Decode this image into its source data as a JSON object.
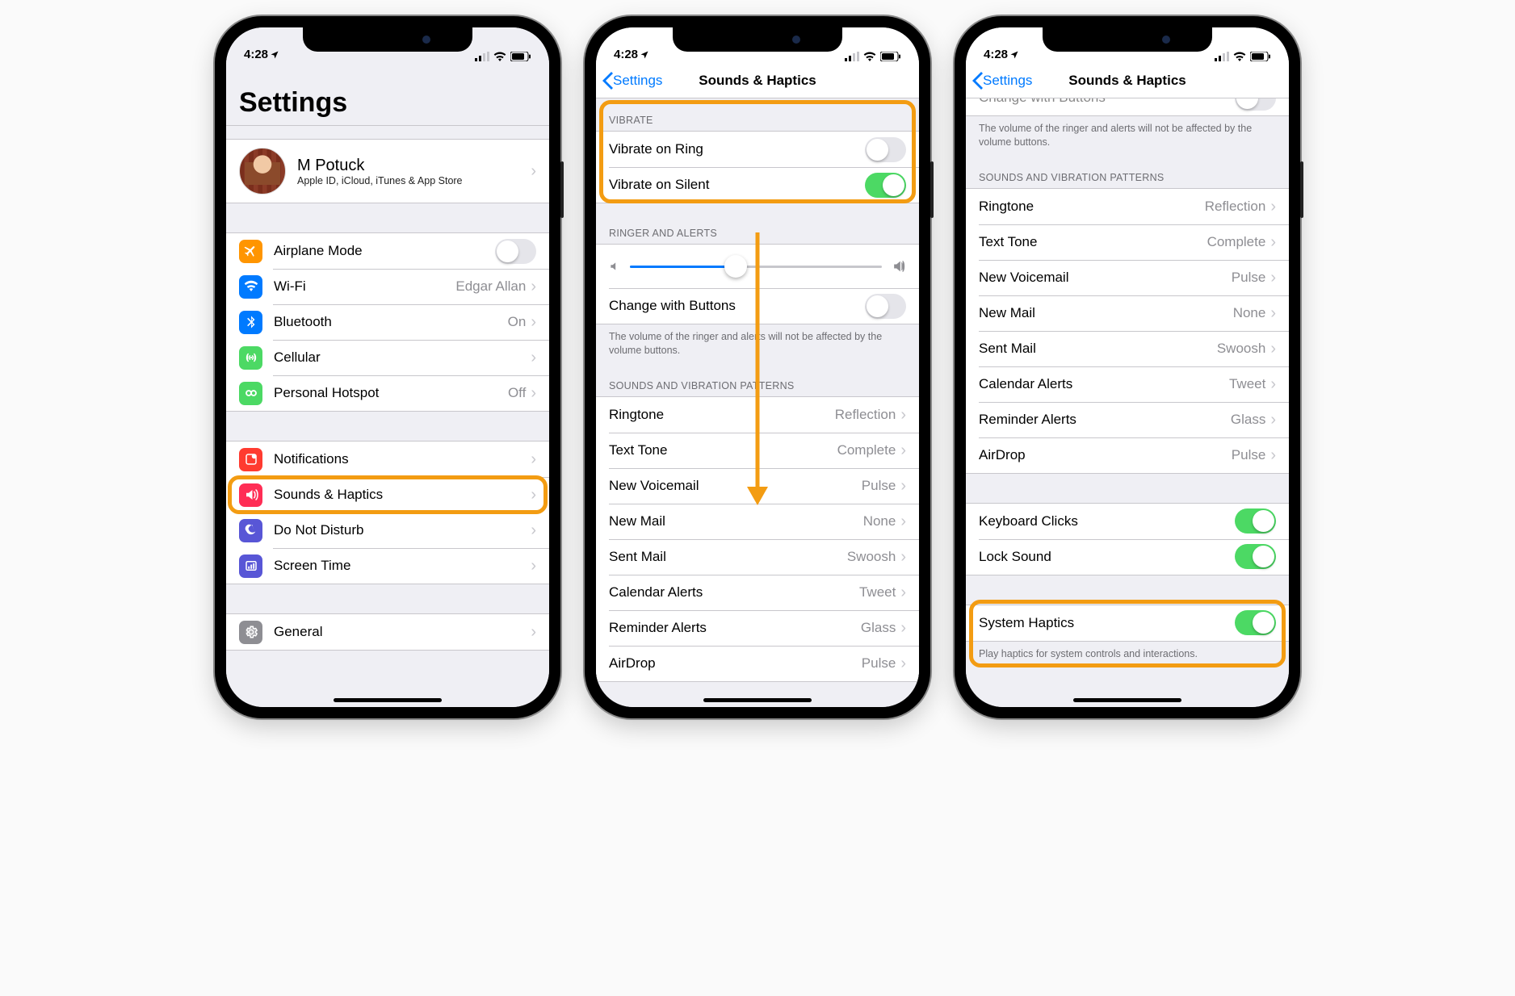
{
  "status": {
    "time": "4:28",
    "location_arrow": true
  },
  "screen1": {
    "title": "Settings",
    "profile": {
      "name": "M Potuck",
      "subtitle": "Apple ID, iCloud, iTunes & App Store"
    },
    "group_a": [
      {
        "icon": "airplane",
        "color": "#ff9500",
        "label": "Airplane Mode",
        "type": "toggle",
        "on": false
      },
      {
        "icon": "wifi",
        "color": "#007aff",
        "label": "Wi-Fi",
        "type": "link",
        "detail": "Edgar Allan"
      },
      {
        "icon": "bluetooth",
        "color": "#007aff",
        "label": "Bluetooth",
        "type": "link",
        "detail": "On"
      },
      {
        "icon": "cellular",
        "color": "#4cd964",
        "label": "Cellular",
        "type": "link",
        "detail": ""
      },
      {
        "icon": "hotspot",
        "color": "#4cd964",
        "label": "Personal Hotspot",
        "type": "link",
        "detail": "Off"
      }
    ],
    "group_b": [
      {
        "icon": "notifications",
        "color": "#ff3b30",
        "label": "Notifications",
        "type": "link"
      },
      {
        "icon": "sounds",
        "color": "#ff2d55",
        "label": "Sounds & Haptics",
        "type": "link",
        "highlight": true
      },
      {
        "icon": "dnd",
        "color": "#5856d6",
        "label": "Do Not Disturb",
        "type": "link"
      },
      {
        "icon": "screentime",
        "color": "#5856d6",
        "label": "Screen Time",
        "type": "link"
      }
    ],
    "group_c": [
      {
        "icon": "general",
        "color": "#8e8e93",
        "label": "General",
        "type": "link"
      }
    ]
  },
  "screen2": {
    "back": "Settings",
    "title": "Sounds & Haptics",
    "vibrate_header": "VIBRATE",
    "vibrate": [
      {
        "label": "Vibrate on Ring",
        "on": false
      },
      {
        "label": "Vibrate on Silent",
        "on": true
      }
    ],
    "ringer_header": "RINGER AND ALERTS",
    "slider_fill_pct": 42,
    "change_buttons_label": "Change with Buttons",
    "change_buttons_on": false,
    "change_buttons_footer": "The volume of the ringer and alerts will not be affected by the volume buttons.",
    "patterns_header": "SOUNDS AND VIBRATION PATTERNS",
    "patterns": [
      {
        "label": "Ringtone",
        "detail": "Reflection"
      },
      {
        "label": "Text Tone",
        "detail": "Complete"
      },
      {
        "label": "New Voicemail",
        "detail": "Pulse"
      },
      {
        "label": "New Mail",
        "detail": "None"
      },
      {
        "label": "Sent Mail",
        "detail": "Swoosh"
      },
      {
        "label": "Calendar Alerts",
        "detail": "Tweet"
      },
      {
        "label": "Reminder Alerts",
        "detail": "Glass"
      },
      {
        "label": "AirDrop",
        "detail": "Pulse"
      }
    ]
  },
  "screen3": {
    "back": "Settings",
    "title": "Sounds & Haptics",
    "top_cut_label": "Change with Buttons",
    "top_footer": "The volume of the ringer and alerts will not be affected by the volume buttons.",
    "patterns_header": "SOUNDS AND VIBRATION PATTERNS",
    "patterns": [
      {
        "label": "Ringtone",
        "detail": "Reflection"
      },
      {
        "label": "Text Tone",
        "detail": "Complete"
      },
      {
        "label": "New Voicemail",
        "detail": "Pulse"
      },
      {
        "label": "New Mail",
        "detail": "None"
      },
      {
        "label": "Sent Mail",
        "detail": "Swoosh"
      },
      {
        "label": "Calendar Alerts",
        "detail": "Tweet"
      },
      {
        "label": "Reminder Alerts",
        "detail": "Glass"
      },
      {
        "label": "AirDrop",
        "detail": "Pulse"
      }
    ],
    "clicks": [
      {
        "label": "Keyboard Clicks",
        "on": true
      },
      {
        "label": "Lock Sound",
        "on": true
      }
    ],
    "haptics_label": "System Haptics",
    "haptics_on": true,
    "haptics_footer": "Play haptics for system controls and interactions."
  }
}
